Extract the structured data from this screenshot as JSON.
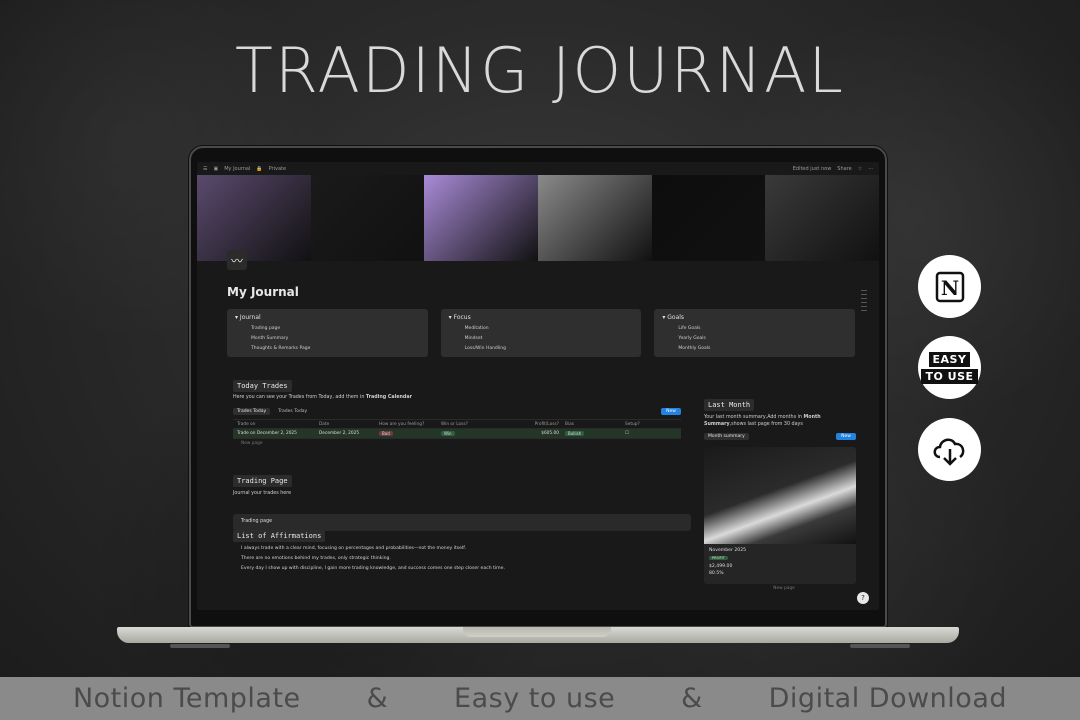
{
  "headline": "TRADING JOURNAL",
  "banner": {
    "items": [
      "Notion Template",
      "&",
      "Easy to use",
      "&",
      "Digital Download"
    ]
  },
  "side_icons": {
    "notion": "notion-logo-icon",
    "easy_line1": "EASY",
    "easy_line2": "TO USE",
    "download": "cloud-download-icon"
  },
  "notion": {
    "breadcrumb": "My Journal",
    "privacy": "Private",
    "edited": "Edited just now",
    "share": "Share",
    "page_title": "My Journal",
    "cover_colors": [
      "#5a4a6e",
      "#1a1a1a",
      "#a98bd8",
      "#8a8a8a",
      "#0d0d0d",
      "#3a3a3a"
    ],
    "callouts": [
      {
        "title": "Journal",
        "items": [
          "Trading page",
          "Month Summary",
          "Thoughts & Remarks Page"
        ]
      },
      {
        "title": "Focus",
        "items": [
          "Meditation",
          "Mindset",
          "Loss/Win Handling"
        ]
      },
      {
        "title": "Goals",
        "items": [
          "Life Goals",
          "Yearly Goals",
          "Monthly Goals"
        ]
      }
    ],
    "today_trades": {
      "title": "Today Trades",
      "desc_prefix": "Here you can see your Trades from Today, add them in",
      "desc_link": "Trading Calendar",
      "tabs": [
        "Trades Today",
        "Trades Today"
      ],
      "new_label": "New",
      "headers": [
        "Trade on",
        "Date",
        "How are you feeling?",
        "Win or Loss?",
        "Profit/Loss?",
        "Bias",
        "Setup?"
      ],
      "row": {
        "name": "Trade on December 2, 2025",
        "date": "December 2, 2025",
        "feeling": "Bad",
        "result": "Win",
        "profit": "$605.00",
        "bias": "Bullish"
      },
      "new_page": "New page"
    },
    "trading_page": {
      "title": "Trading Page",
      "desc": "Journal your trades here",
      "link": "Trading page"
    },
    "affirmations": {
      "title": "List of Affirmations",
      "items": [
        "I always trade with a clear mind, focusing on percentages and probabilities—not the money itself.",
        "There are no emotions behind my trades, only strategic thinking.",
        "Every day I show up with discipline, I gain more trading knowledge, and success comes one step closer each time."
      ]
    },
    "last_month": {
      "title": "Last Month",
      "desc": "Your last month summary,Add months in",
      "desc_link": "Month Summary",
      "desc_suffix": ",shows last page from 30 days",
      "tab": "Month summary",
      "new_label": "New",
      "card_title": "November 2025",
      "card_badge": "PROFIT",
      "card_amount": "$2,499.00",
      "card_pct": "80.5%",
      "new_page": "New page"
    },
    "help": "?"
  }
}
